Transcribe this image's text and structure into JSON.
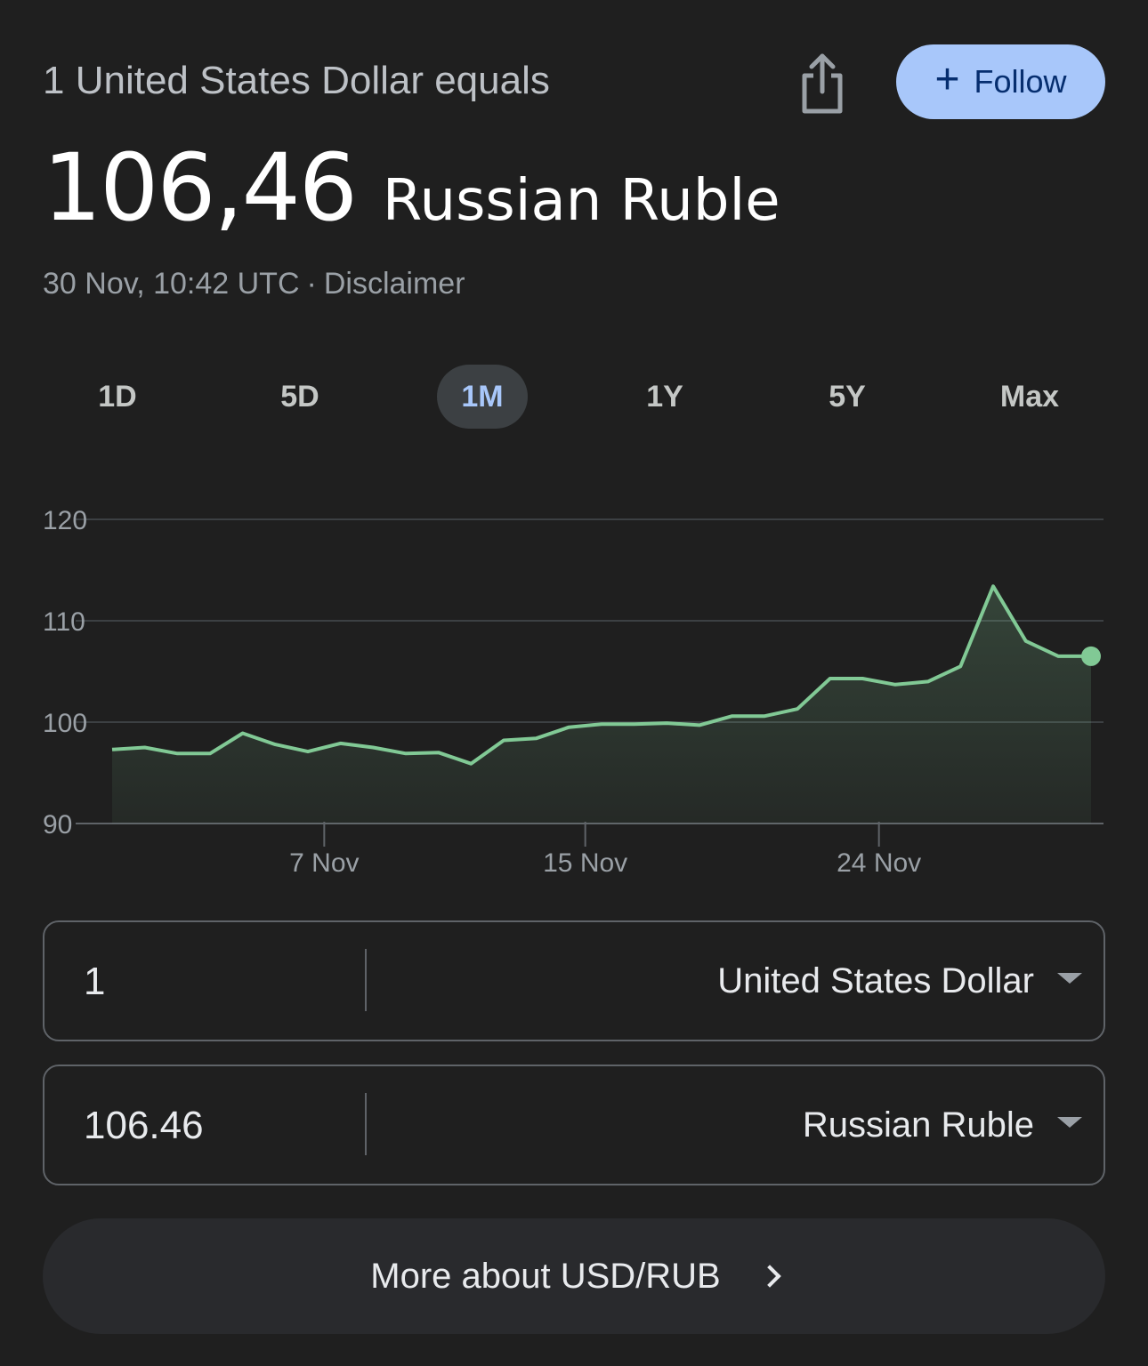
{
  "header": {
    "conversion_label": "1 United States Dollar equals",
    "share_icon": "share-icon",
    "follow_label": "Follow",
    "follow_icon": "plus-icon"
  },
  "rate": {
    "value": "106,46",
    "currency": "Russian Ruble"
  },
  "meta": {
    "timestamp": "30 Nov, 10:42 UTC",
    "separator": "·",
    "disclaimer": "Disclaimer"
  },
  "range_tabs": [
    {
      "label": "1D",
      "active": false
    },
    {
      "label": "5D",
      "active": false
    },
    {
      "label": "1M",
      "active": true
    },
    {
      "label": "1Y",
      "active": false
    },
    {
      "label": "5Y",
      "active": false
    },
    {
      "label": "Max",
      "active": false
    }
  ],
  "chart_data": {
    "type": "area",
    "y_ticks": [
      "120",
      "110",
      "100",
      "90"
    ],
    "y_tick_values": [
      120,
      110,
      100,
      90
    ],
    "ylim": [
      90,
      120
    ],
    "grid": true,
    "x_ticks": [
      {
        "label": "7 Nov",
        "day": 7
      },
      {
        "label": "15 Nov",
        "day": 15
      },
      {
        "label": "24 Nov",
        "day": 24
      }
    ],
    "x_range_days": [
      0.5,
      30.5
    ],
    "series": [
      {
        "color": "#81c995",
        "points": [
          [
            0.5,
            97.3
          ],
          [
            1.5,
            97.5
          ],
          [
            2.5,
            96.9
          ],
          [
            3.5,
            96.9
          ],
          [
            4.5,
            98.9
          ],
          [
            5.5,
            97.8
          ],
          [
            6.5,
            97.1
          ],
          [
            7.5,
            97.9
          ],
          [
            8.5,
            97.5
          ],
          [
            9.5,
            96.9
          ],
          [
            10.5,
            97.0
          ],
          [
            11.5,
            95.9
          ],
          [
            12.5,
            98.2
          ],
          [
            13.5,
            98.4
          ],
          [
            14.5,
            99.5
          ],
          [
            15.5,
            99.8
          ],
          [
            16.5,
            99.8
          ],
          [
            17.5,
            99.9
          ],
          [
            18.5,
            99.7
          ],
          [
            19.5,
            100.6
          ],
          [
            20.5,
            100.6
          ],
          [
            21.5,
            101.3
          ],
          [
            22.5,
            104.3
          ],
          [
            23.5,
            104.3
          ],
          [
            24.5,
            103.7
          ],
          [
            25.5,
            104.0
          ],
          [
            26.5,
            105.5
          ],
          [
            27.5,
            113.4
          ],
          [
            28.5,
            108.0
          ],
          [
            29.5,
            106.5
          ],
          [
            30.5,
            106.5
          ]
        ]
      }
    ]
  },
  "converter": {
    "from": {
      "amount": "1",
      "currency": "United States Dollar"
    },
    "to": {
      "amount": "106.46",
      "currency": "Russian Ruble"
    }
  },
  "more": {
    "label": "More about USD/RUB",
    "icon": "chevron-right-icon"
  }
}
